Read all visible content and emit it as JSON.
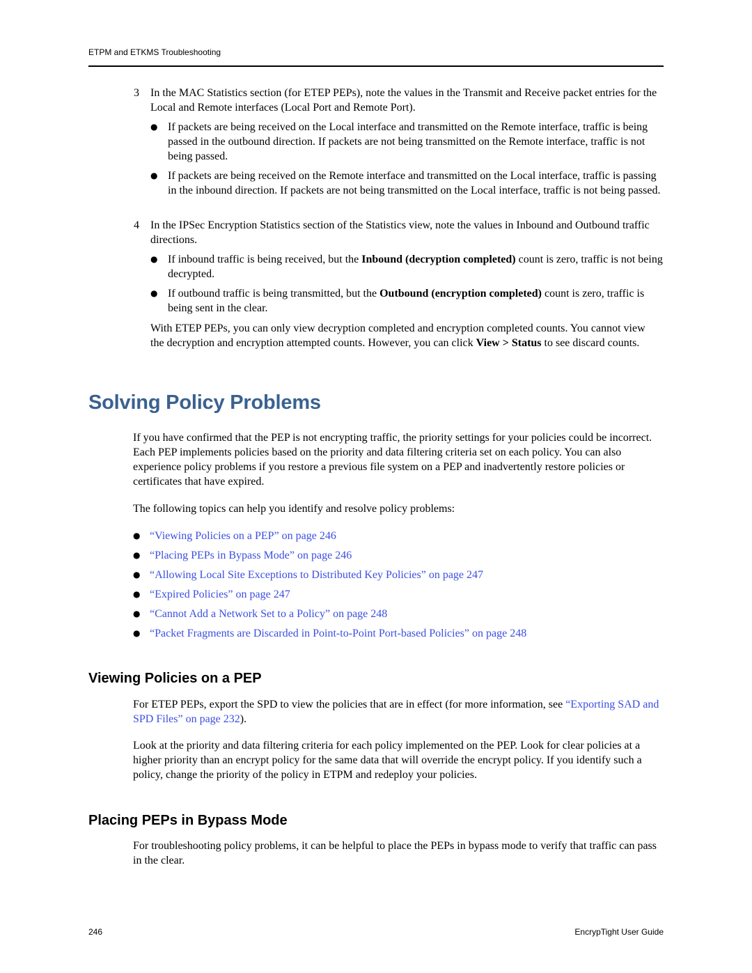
{
  "header": {
    "running_title": "ETPM and ETKMS Troubleshooting"
  },
  "steps": [
    {
      "number": "3",
      "text": "In the MAC Statistics section (for ETEP PEPs), note the values in the Transmit and Receive packet entries for the Local and Remote interfaces (Local Port and Remote Port).",
      "bullets": [
        "If packets are being received on the Local interface and transmitted on the Remote interface, traffic is being passed in the outbound direction. If packets are not being transmitted on the Remote interface, traffic is not being passed.",
        "If packets are being received on the Remote interface and transmitted on the Local interface, traffic is passing in the inbound direction. If packets are not being transmitted on the Local interface, traffic is not being passed."
      ]
    },
    {
      "number": "4",
      "text": "In the IPSec Encryption Statistics section of the Statistics view, note the values in Inbound and Outbound traffic directions.",
      "bullets": [
        {
          "before": "If inbound traffic is being received, but the ",
          "bold": "Inbound (decryption completed)",
          "after": " count is zero, traffic is not being decrypted."
        },
        {
          "before": "If outbound traffic is being transmitted, but the ",
          "bold": "Outbound (encryption completed)",
          "after": " count is zero, traffic is being sent in the clear."
        }
      ],
      "note": {
        "before": "With ETEP PEPs, you can only view decryption completed and encryption completed counts. You cannot view the decryption and encryption attempted counts. However, you can click ",
        "bold": "View > Status",
        "after": " to see discard counts."
      }
    }
  ],
  "section": {
    "title": "Solving Policy Problems",
    "intro": "If you have confirmed that the PEP is not encrypting traffic, the priority settings for your policies could be incorrect. Each PEP implements policies based on the priority and data filtering criteria set on each policy. You can also experience policy problems if you restore a previous file system on a PEP and inadvertently restore policies or certificates that have expired.",
    "topics_lead": "The following topics can help you identify and resolve policy problems:",
    "topics": [
      "“Viewing Policies on a PEP” on page 246",
      "“Placing PEPs in Bypass Mode” on page 246",
      "“Allowing Local Site Exceptions to Distributed Key Policies” on page 247",
      "“Expired Policies” on page 247",
      "“Cannot Add a Network Set to a Policy” on page 248",
      "“Packet Fragments are Discarded in Point-to-Point Port-based Policies” on page 248"
    ]
  },
  "subsections": [
    {
      "title": "Viewing Policies on a PEP",
      "para1_before": "For ETEP PEPs, export the SPD to view the policies that are in effect (for more information, see ",
      "para1_link": "“Exporting SAD and SPD Files” on page 232",
      "para1_after": ").",
      "para2": "Look at the priority and data filtering criteria for each policy implemented on the PEP. Look for clear policies at a higher priority than an encrypt policy for the same data that will override the encrypt policy. If you identify such a policy, change the priority of the policy in ETPM and redeploy your policies."
    },
    {
      "title": "Placing PEPs in Bypass Mode",
      "para1": "For troubleshooting policy problems, it can be helpful to place the PEPs in bypass mode to verify that traffic can pass in the clear."
    }
  ],
  "footer": {
    "page_number": "246",
    "guide_title": "EncrypTight User Guide"
  },
  "colors": {
    "heading_blue": "#3a6190",
    "link_blue": "#3b4fe0"
  }
}
